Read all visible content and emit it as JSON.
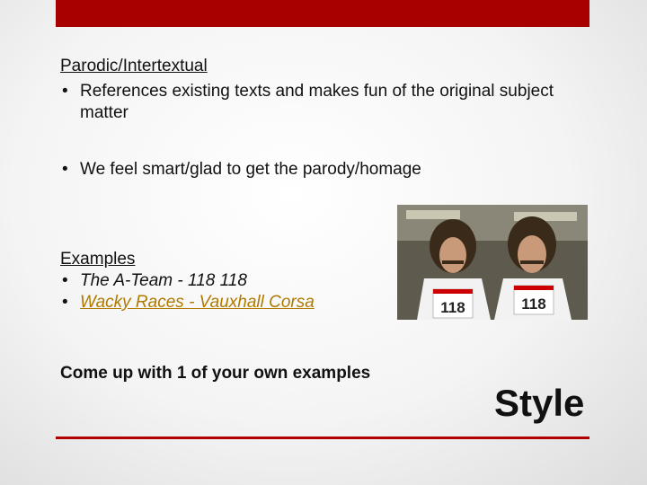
{
  "slide": {
    "heading": "Parodic/Intertextual",
    "bullets": [
      "References existing texts and makes fun of the original subject matter",
      "We feel smart/glad to get the parody/homage"
    ],
    "examples_heading": "Examples",
    "examples": [
      {
        "text": "The A-Team - 118 118"
      },
      {
        "text": "Wacky Races - Vauxhall Corsa",
        "link": true
      }
    ],
    "prompt": "Come up with 1 of your own examples",
    "title": "Style",
    "photo_bibs": [
      "118",
      "118"
    ]
  },
  "colors": {
    "accent_bar": "#a80000",
    "link": "#b07a00"
  }
}
